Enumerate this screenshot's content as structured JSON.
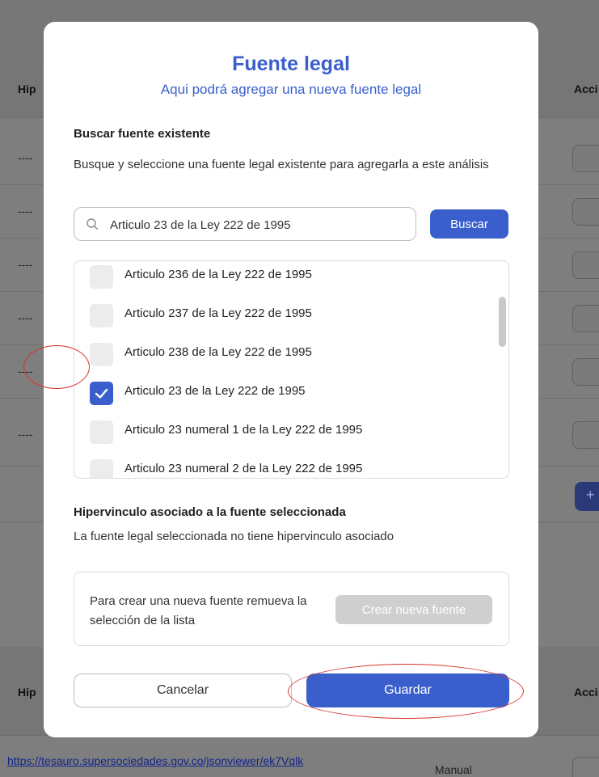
{
  "background": {
    "column_left_header": "Hip",
    "column_right_header": "Acci",
    "row_placeholder": "----",
    "add_button_label": "+",
    "link_text": "https://tesauro.supersociedades.gov.co/jsonviewer/ek7Vqlk",
    "manual_label": "Manual"
  },
  "modal": {
    "title": "Fuente legal",
    "subtitle": "Aqui podrá agregar una nueva fuente legal",
    "search_section": {
      "title": "Buscar fuente existente",
      "description": "Busque y seleccione una fuente legal existente para agregarla a este análisis",
      "search_value": "Articulo 23 de la Ley 222 de 1995",
      "search_icon": "search-icon",
      "search_button": "Buscar"
    },
    "results": [
      {
        "label": "Articulo 236 de la Ley 222 de 1995",
        "checked": false
      },
      {
        "label": "Articulo 237 de la Ley 222 de 1995",
        "checked": false
      },
      {
        "label": "Articulo 238 de la Ley 222 de 1995",
        "checked": false
      },
      {
        "label": "Articulo 23 de la Ley 222 de 1995",
        "checked": true
      },
      {
        "label": "Articulo 23 numeral 1 de la Ley 222 de 1995",
        "checked": false
      },
      {
        "label": "Articulo 23 numeral 2 de la Ley 222 de 1995",
        "checked": false
      }
    ],
    "hyperlink_section": {
      "title": "Hipervinculo asociado a la fuente seleccionada",
      "description": "La fuente legal seleccionada no tiene hipervinculo asociado"
    },
    "new_source": {
      "text": "Para crear una nueva fuente remueva la selección de la lista",
      "button": "Crear nueva fuente"
    },
    "cancel_button": "Cancelar",
    "save_button": "Guardar"
  },
  "colors": {
    "accent": "#3a5fcd",
    "annotation": "#d9342b",
    "disabled_button": "#cfcfcf"
  }
}
